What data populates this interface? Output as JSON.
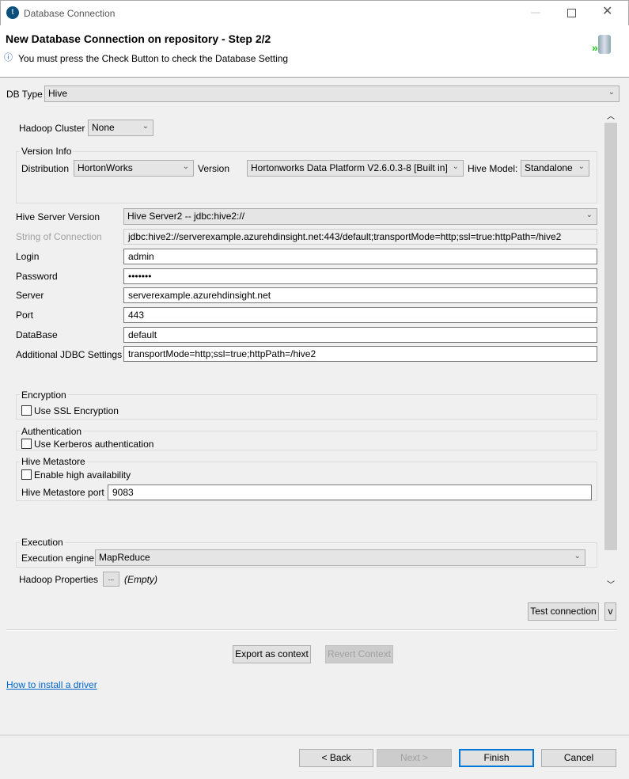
{
  "window": {
    "title": "Database Connection"
  },
  "header": {
    "title": "New Database Connection on repository - Step 2/2",
    "info": "You must press the Check Button to check the Database Setting"
  },
  "db_type": {
    "label": "DB Type",
    "value": "Hive"
  },
  "hadoop_cluster": {
    "label": "Hadoop Cluster",
    "value": "None"
  },
  "version_info": {
    "group": "Version Info",
    "distribution_label": "Distribution",
    "distribution": "HortonWorks",
    "version_label": "Version",
    "version": "Hortonworks Data Platform V2.6.0.3-8 [Built in]",
    "hive_model_label": "Hive Model:",
    "hive_model": "Standalone"
  },
  "fields": {
    "hive_server_label": "Hive Server Version",
    "hive_server": "Hive Server2 -- jdbc:hive2://",
    "conn_label": "String of Connection",
    "conn": "jdbc:hive2://serverexample.azurehdinsight.net:443/default;transportMode=http;ssl=true:httpPath=/hive2",
    "login_label": "Login",
    "login": "admin",
    "password_label": "Password",
    "password": "•••••••",
    "server_label": "Server",
    "server": "serverexample.azurehdinsight.net",
    "port_label": "Port",
    "port": "443",
    "database_label": "DataBase",
    "database": "default",
    "jdbc_label": "Additional JDBC Settings",
    "jdbc": "transportMode=http;ssl=true;httpPath=/hive2"
  },
  "encryption": {
    "group": "Encryption",
    "ssl": "Use SSL Encryption"
  },
  "authentication": {
    "group": "Authentication",
    "kerberos": "Use Kerberos authentication"
  },
  "metastore": {
    "group": "Hive Metastore",
    "ha": "Enable high availability",
    "port_label": "Hive Metastore port",
    "port": "9083"
  },
  "execution": {
    "group": "Execution",
    "engine_label": "Execution engine",
    "engine": "MapReduce"
  },
  "hadoop_props": {
    "label": "Hadoop Properties",
    "button": "...",
    "value": "(Empty)"
  },
  "buttons": {
    "test": "Test connection",
    "v": "v",
    "export": "Export as context",
    "revert": "Revert Context",
    "back": "< Back",
    "next": "Next >",
    "finish": "Finish",
    "cancel": "Cancel"
  },
  "link": "How to install a driver"
}
